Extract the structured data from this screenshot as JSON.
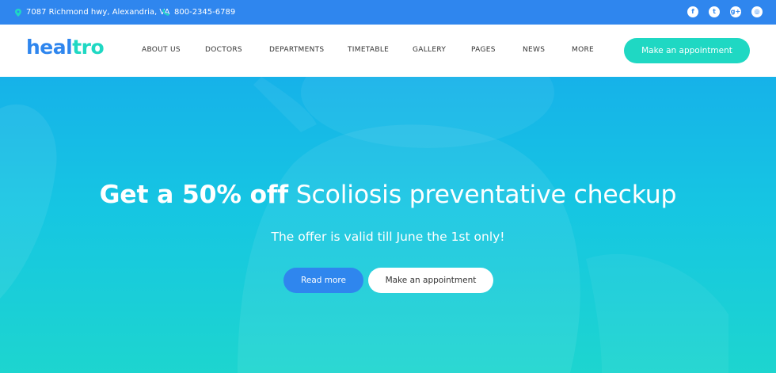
{
  "topbar": {
    "address": "7087 Richmond hwy, Alexandria, VA",
    "phone": "800-2345-6789",
    "socials": [
      {
        "icon": "facebook-icon",
        "glyph": "f"
      },
      {
        "icon": "twitter-icon",
        "glyph": "t"
      },
      {
        "icon": "google-plus-icon",
        "glyph": "g+"
      },
      {
        "icon": "instagram-icon",
        "glyph": "◎"
      }
    ]
  },
  "header": {
    "logo_part1": "heal",
    "logo_part2": "tro",
    "nav": [
      "ABOUT US",
      "DOCTORS",
      "DEPARTMENTS",
      "TIMETABLE",
      "GALLERY",
      "PAGES",
      "NEWS",
      "MORE"
    ],
    "cta": "Make an appointment"
  },
  "hero": {
    "title_bold": "Get a 50% off",
    "title_light": "Scoliosis preventative checkup",
    "subtitle": "The offer is valid till June the 1st only!",
    "read_more": "Read more",
    "appointment": "Make an appointment"
  },
  "colors": {
    "primary": "#2f86ee",
    "accent": "#1fd8c3"
  }
}
